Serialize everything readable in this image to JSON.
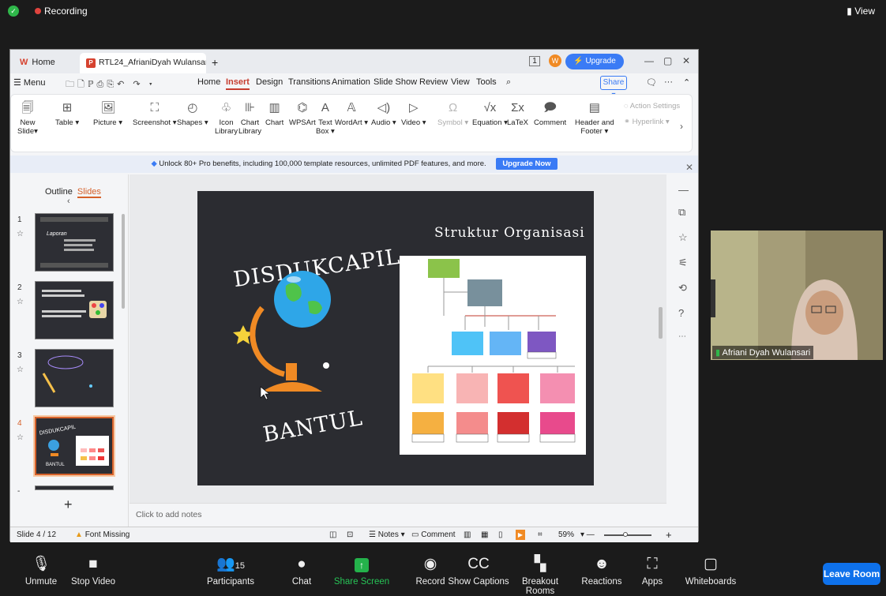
{
  "zoom_top": {
    "recording": "Recording",
    "view": "View"
  },
  "wps": {
    "tab_home": "Home",
    "doc_tab": "RTL24_AfrianiDyah Wulansari.p",
    "upgrade": "Upgrade now",
    "menu": [
      "Menu",
      "Home",
      "Insert",
      "Design",
      "Transitions",
      "Animation",
      "Slide Show",
      "Review",
      "View",
      "Tools"
    ],
    "share": "Share",
    "ribbon": [
      {
        "icon": "new-slide-icon",
        "label1": "New",
        "label2": "Slide▾"
      },
      {
        "icon": "table-icon",
        "label1": "Table ▾",
        "label2": ""
      },
      {
        "icon": "picture-icon",
        "label1": "Picture ▾",
        "label2": ""
      },
      {
        "icon": "screenshot-icon",
        "label1": "Screenshot ▾",
        "label2": ""
      },
      {
        "icon": "shapes-icon",
        "label1": "Shapes ▾",
        "label2": ""
      },
      {
        "icon": "icon-library-icon",
        "label1": "Icon",
        "label2": "Library"
      },
      {
        "icon": "chart-library-icon",
        "label1": "Chart",
        "label2": "Library"
      },
      {
        "icon": "chart-icon",
        "label1": "Chart",
        "label2": ""
      },
      {
        "icon": "wpsart-icon",
        "label1": "WPSArt",
        "label2": ""
      },
      {
        "icon": "textbox-icon",
        "label1": "Text",
        "label2": "Box ▾"
      },
      {
        "icon": "wordart-icon",
        "label1": "WordArt ▾",
        "label2": ""
      },
      {
        "icon": "audio-icon",
        "label1": "Audio ▾",
        "label2": ""
      },
      {
        "icon": "video-icon",
        "label1": "Video ▾",
        "label2": ""
      },
      {
        "icon": "symbol-icon",
        "label1": "Symbol ▾",
        "label2": ""
      },
      {
        "icon": "equation-icon",
        "label1": "Equation ▾",
        "label2": ""
      },
      {
        "icon": "latex-icon",
        "label1": "LaTeX",
        "label2": ""
      },
      {
        "icon": "comment-icon",
        "label1": "Comment",
        "label2": ""
      },
      {
        "icon": "header-footer-icon",
        "label1": "Header and",
        "label2": "Footer ▾"
      }
    ],
    "ribbon_side": {
      "action": "Action Settings",
      "hyperlink": "Hyperlink ▾"
    },
    "promo": "Unlock 80+ Pro benefits, including 100,000 template resources, unlimited PDF features, and more.",
    "promo_btn": "Upgrade Now",
    "panel_tabs": {
      "outline": "Outline",
      "slides": "Slides"
    },
    "slide_numbers": [
      "1",
      "2",
      "3",
      "4",
      "-"
    ],
    "slide": {
      "title_left": "DISDUKCAPIL",
      "title_bottom": "BANTUL",
      "title_right": "Struktur Organisasi"
    },
    "thumb1_title": "Laporan",
    "thumb4_title": "DISDUKCAPIL",
    "thumb4_sub": "BANTUL",
    "notes": "Click to add notes",
    "status": {
      "slide": "Slide 4 / 12",
      "font": "Font Missing",
      "notes": "Notes ▾",
      "comment": "Comment",
      "zoom": "59%"
    }
  },
  "video": {
    "name": "Afriani Dyah Wulansari"
  },
  "zoom_bottom": {
    "buttons": [
      {
        "label": "Unmute"
      },
      {
        "label": "Stop Video"
      },
      {
        "label": "Participants",
        "count": "15"
      },
      {
        "label": "Chat"
      },
      {
        "label": "Share Screen"
      },
      {
        "label": "Record"
      },
      {
        "label": "Show Captions"
      },
      {
        "label": "Breakout Rooms"
      },
      {
        "label": "Reactions"
      },
      {
        "label": "Apps"
      },
      {
        "label": "Whiteboards"
      }
    ],
    "leave": "Leave Room"
  }
}
